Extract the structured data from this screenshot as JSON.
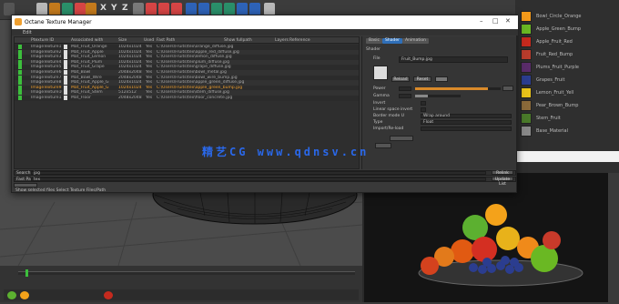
{
  "toolbar": {
    "axis_x": "X",
    "axis_y": "Y",
    "axis_z": "Z"
  },
  "dialog": {
    "title": "Octane Texture Manager",
    "menu_label": "Edit",
    "columns": [
      "Ptexture ID",
      "Associated with",
      "Size",
      "Used",
      "Fast Path",
      "Show fullpath",
      "Layers",
      "Reference"
    ],
    "rows": [
      {
        "name": "ImageTexture1",
        "mat": "Mat_Fruit_Orange",
        "size": "1024x1024",
        "used": "Yes",
        "path": "C:\\Users\\Fruits\\tex\\orange_diffuse.jpg",
        "selected": false
      },
      {
        "name": "ImageTexture2",
        "mat": "Mat_Fruit_Apple",
        "size": "1024x1024",
        "used": "Yes",
        "path": "C:\\Users\\Fruits\\tex\\apple_red_diffuse.jpg",
        "selected": false
      },
      {
        "name": "ImageTexture3",
        "mat": "Mat_Fruit_Lemon",
        "size": "1024x1024",
        "used": "Yes",
        "path": "C:\\Users\\Fruits\\tex\\lemon_diffuse.jpg",
        "selected": false
      },
      {
        "name": "ImageTexture4",
        "mat": "Mat_Fruit_Plum",
        "size": "1024x1024",
        "used": "Yes",
        "path": "C:\\Users\\Fruits\\tex\\plum_diffuse.jpg",
        "selected": false
      },
      {
        "name": "ImageTexture5",
        "mat": "Mat_Fruit_Grape",
        "size": "1024x1024",
        "used": "Yes",
        "path": "C:\\Users\\Fruits\\tex\\grape_diffuse.jpg",
        "selected": false
      },
      {
        "name": "ImageTexture6",
        "mat": "Mat_Bowl",
        "size": "2048x2048",
        "used": "Yes",
        "path": "C:\\Users\\Fruits\\tex\\bowl_metal.jpg",
        "selected": false
      },
      {
        "name": "ImageTexture7",
        "mat": "Mat_Bowl_Wire",
        "size": "2048x2048",
        "used": "Yes",
        "path": "C:\\Users\\Fruits\\tex\\bowl_wire_bump.jpg",
        "selected": false
      },
      {
        "name": "ImageTexture8",
        "mat": "Mat_Fruit_Apple_G",
        "size": "1024x1024",
        "used": "Yes",
        "path": "C:\\Users\\Fruits\\tex\\apple_green_diffuse.jpg",
        "selected": false
      },
      {
        "name": "ImageTexture9",
        "mat": "Mat_Fruit_Apple_G",
        "size": "1024x1024",
        "used": "Yes",
        "path": "C:\\Users\\Fruits\\tex\\apple_green_bump.jpg",
        "selected": true
      },
      {
        "name": "ImageTexture10",
        "mat": "Mat_Fruit_Stem",
        "size": "512x512",
        "used": "Yes",
        "path": "C:\\Users\\Fruits\\tex\\stem_diffuse.jpg",
        "selected": false
      },
      {
        "name": "ImageTexture11",
        "mat": "Mat_Floor",
        "size": "2048x2048",
        "used": "Yes",
        "path": "C:\\Users\\Fruits\\tex\\floor_concrete.jpg",
        "selected": false
      }
    ],
    "props": {
      "tabs": [
        "Basic",
        "Shader",
        "Animation"
      ],
      "header": "Shader",
      "file_label": "File",
      "file_value": "Fruit_Bump.jpg",
      "power_label": "Power",
      "gamma_label": "Gamma",
      "invert_label": "Invert",
      "linear_label": "Linear space invert",
      "border_label": "Border mode U",
      "border_value": "Wrap around",
      "type_label": "Type",
      "type_value": "Float",
      "import_label": "Import/Re-load",
      "btn_reload": "Reload",
      "btn_reset": "Reset"
    },
    "bottom": {
      "search_label": "Search",
      "search_value": "jpg",
      "path_label": "Fast Path",
      "path_value": "tex",
      "btn_relink": "Relink",
      "btn_update": "Update List",
      "status": "Show selected files   Select Texture Files/Path"
    }
  },
  "right_panel": {
    "items": [
      "Bowl_Circle_Orange",
      "Apple_Green_Bump",
      "Apple_Fruit_Red",
      "Fruit_Red_Bump",
      "Plums_Fruit_Purple",
      "Grapes_Fruit",
      "Lemon_Fruit_Yell",
      "Pear_Brown_Bump",
      "Stem_Fruit",
      "Base_Material"
    ]
  },
  "watermark": "精艺CG www.qdnsv.cn"
}
